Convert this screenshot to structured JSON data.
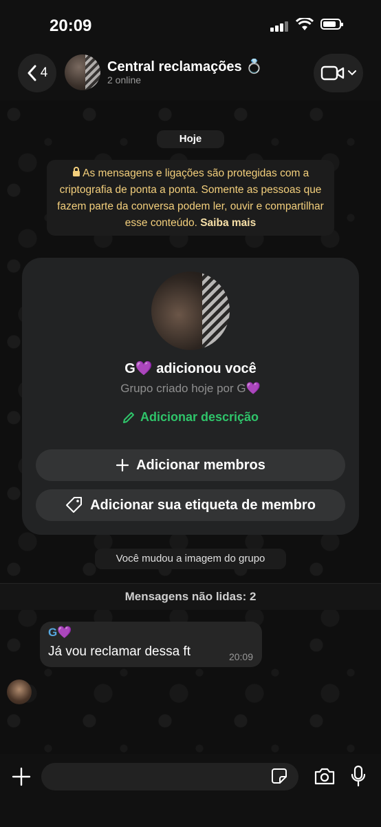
{
  "status_bar": {
    "time": "20:09"
  },
  "header": {
    "back_count": "4",
    "title": "Central reclamações 💍",
    "subtitle": "2 online"
  },
  "chat": {
    "date_chip": "Hoje",
    "encryption_notice": "As mensagens e ligações são protegidas com a criptografia de ponta a ponta. Somente as pessoas que fazem parte da conversa podem ler, ouvir e compartilhar esse conteúdo.",
    "encryption_link": "Saiba mais",
    "group_card": {
      "added_text": "G💜 adicionou você",
      "created_text": "Grupo criado hoje por G💜",
      "add_description": "Adicionar descrição",
      "add_members": "Adicionar membros",
      "add_tag": "Adicionar sua etiqueta de membro"
    },
    "system_message": "Você mudou a imagem do grupo",
    "unread_divider": "Mensagens não lidas: 2",
    "messages": [
      {
        "sender": "G💜",
        "text": "Já vou reclamar dessa ft",
        "time": "20:09"
      }
    ]
  },
  "composer": {
    "placeholder": ""
  },
  "colors": {
    "accent_green": "#2fc46a",
    "sender_blue": "#57a8e0",
    "notice_yellow": "#f3cf7c"
  },
  "icons": [
    "back-chevron-icon",
    "video-camera-icon",
    "lock-icon",
    "pencil-icon",
    "plus-icon",
    "tag-icon",
    "sticker-icon",
    "camera-icon",
    "microphone-icon"
  ]
}
